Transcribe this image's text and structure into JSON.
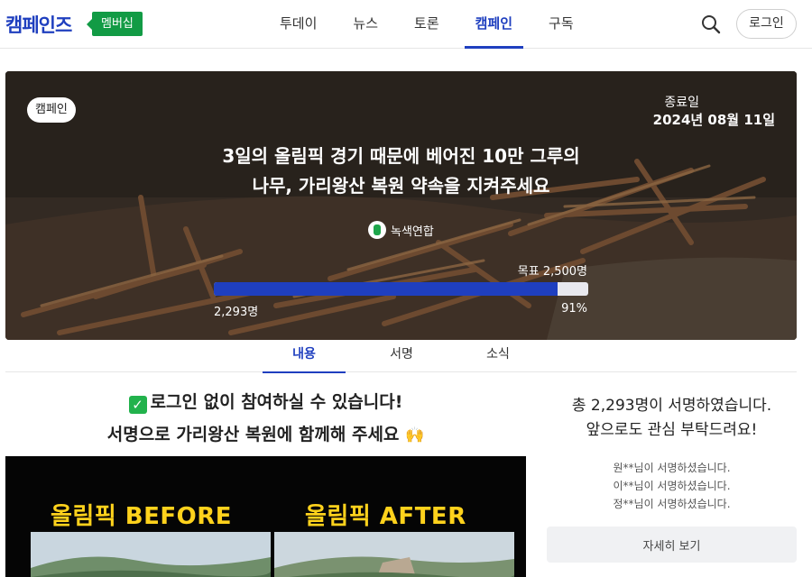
{
  "header": {
    "logo": "캠페인즈",
    "badge": "멤버십",
    "nav": [
      "투데이",
      "뉴스",
      "토론",
      "캠페인",
      "구독"
    ],
    "active_nav": "캠페인",
    "login": "로그인"
  },
  "hero": {
    "tag": "캠페인",
    "end_label": "종료일",
    "end_date": "2024년 08월 11일",
    "title_line1": "3일의 올림픽 경기 때문에 베어진 10만 그루의",
    "title_line2": "나무, 가리왕산 복원 약속을 지켜주세요",
    "org": "녹색연합",
    "goal": "목표 2,500명",
    "count": "2,293명",
    "percent": "91%",
    "progress": 0.917
  },
  "tabs": [
    "내용",
    "서명",
    "소식"
  ],
  "active_tab": "내용",
  "main": {
    "headline1": "로그인 없이 참여하실 수 있습니다!",
    "headline2": "서명으로 가리왕산 복원에 함께해 주세요",
    "image_before": "올림픽 BEFORE",
    "image_after": "올림픽 AFTER"
  },
  "sidebar": {
    "total_line1": "총 2,293명이 서명하였습니다.",
    "total_line2": "앞으로도 관심 부탁드려요!",
    "signers": [
      "원**님이 서명하셨습니다.",
      "이**님이 서명하셨습니다.",
      "정**님이 서명하셨습니다."
    ],
    "more_button": "자세히 보기"
  },
  "colors": {
    "brand": "#1f3fbf",
    "badge": "#129b45",
    "highlight": "#ffd21c"
  }
}
